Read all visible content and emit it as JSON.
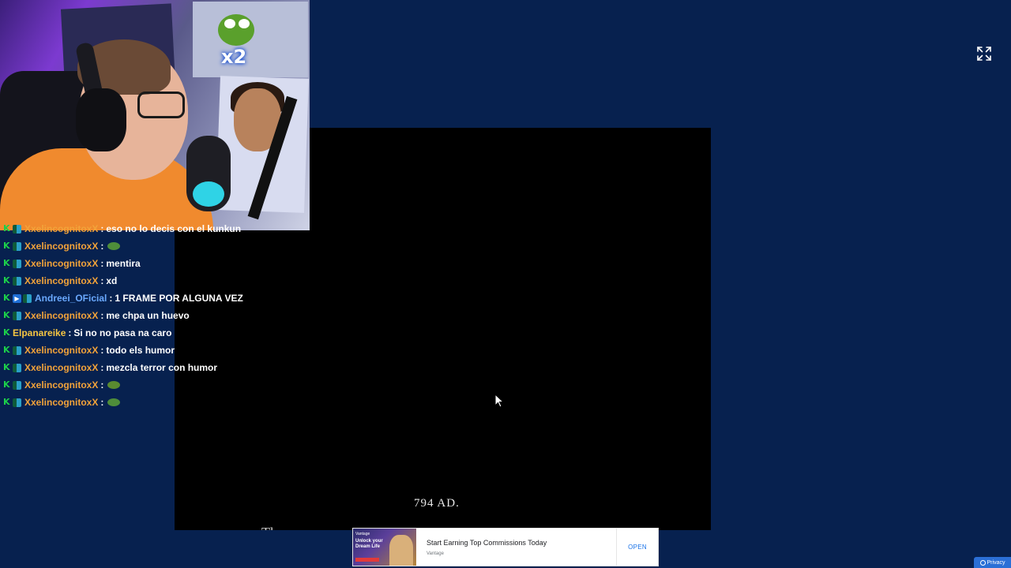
{
  "player": {
    "year_text": "794 AD.",
    "subtitle_partial": "The"
  },
  "webcam": {
    "multiplier_label": "x2"
  },
  "chat": {
    "messages": [
      {
        "user": "XxelincognitoxX",
        "text": "eso no lo decis con el kunkun",
        "color": "#f2a33a",
        "badges": [
          "k",
          "sub"
        ]
      },
      {
        "user": "XxelincognitoxX",
        "text": "",
        "emote": "pepe-emote",
        "color": "#f2a33a",
        "badges": [
          "k",
          "sub"
        ]
      },
      {
        "user": "XxelincognitoxX",
        "text": "mentira",
        "color": "#f2a33a",
        "badges": [
          "k",
          "sub"
        ]
      },
      {
        "user": "XxelincognitoxX",
        "text": "xd",
        "color": "#f2a33a",
        "badges": [
          "k",
          "sub"
        ]
      },
      {
        "user": "Andreei_OFicial",
        "text": "1 FRAME POR ALGUNA VEZ",
        "color": "#6aa9ff",
        "badges": [
          "k",
          "vip",
          "sub"
        ]
      },
      {
        "user": "XxelincognitoxX",
        "text": "me chpa un huevo",
        "color": "#f2a33a",
        "badges": [
          "k",
          "sub"
        ]
      },
      {
        "user": "Elpanareike",
        "text": "Si no no pasa na caro",
        "color": "#f5c542",
        "badges": [
          "k"
        ]
      },
      {
        "user": "XxelincognitoxX",
        "text": "todo els humor",
        "color": "#f2a33a",
        "badges": [
          "k",
          "sub"
        ]
      },
      {
        "user": "XxelincognitoxX",
        "text": "mezcla terror con humor",
        "color": "#f2a33a",
        "badges": [
          "k",
          "sub"
        ]
      },
      {
        "user": "XxelincognitoxX",
        "text": "",
        "emote": "pepe-peek-emote",
        "color": "#f2a33a",
        "badges": [
          "k",
          "sub"
        ]
      },
      {
        "user": "XxelincognitoxX",
        "text": "",
        "emote": "pepe-emote",
        "color": "#f2a33a",
        "badges": [
          "k",
          "sub"
        ]
      }
    ],
    "separator": ":"
  },
  "ad": {
    "thumb_brand": "Vantage",
    "thumb_headline": "Unlock your Dream Life",
    "title": "Start Earning Top Commissions Today",
    "source": "Vantage",
    "cta": "OPEN"
  },
  "privacy": {
    "label": "Privacy"
  },
  "icons": {
    "fullscreen": "fullscreen-expand-icon",
    "cursor": "mouse-cursor-icon",
    "privacy": "privacy-gear-icon"
  }
}
